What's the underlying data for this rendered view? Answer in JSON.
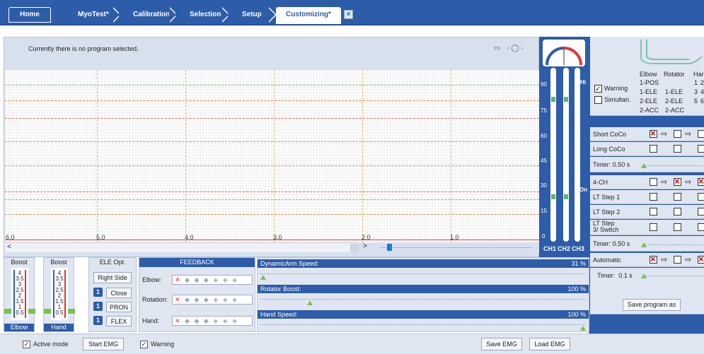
{
  "nav": {
    "home": "Home",
    "crumbs": [
      "MyoTest*",
      "Calibration",
      "Selection",
      "Setup"
    ],
    "active": "Customizing*"
  },
  "plot": {
    "status": "Currently there is no program selected.",
    "x_ticks": [
      "6.0",
      "5.0",
      "4.0",
      "3.0",
      "2.0",
      "1.0"
    ],
    "scroll_left": "<",
    "scroll_right": ">"
  },
  "meters": {
    "ticks": [
      "90",
      "75",
      "60",
      "45",
      "30",
      "15",
      "0"
    ],
    "hi_label": "Hi",
    "on_label": "On",
    "channels": [
      "CH1",
      "CH2",
      "CH3"
    ]
  },
  "settings": {
    "warning": "Warning",
    "simultan": "Simultan.",
    "col_elbow": "Elbow",
    "col_rotator": "Rotator",
    "col_hand": "Hand",
    "elbow_modes": [
      "1-POS",
      "1-ELE",
      "2-ELE",
      "2-ACC"
    ],
    "rotator_modes": [
      "1-ELE",
      "2-ELE",
      "2-ACC"
    ],
    "hand_nums": [
      "1",
      "2",
      "3",
      "4",
      "5",
      "6"
    ],
    "short_coco": "Short CoCo",
    "long_coco": "Long CoCo",
    "timer1": "Timer:",
    "timer1_val": "0.50 s",
    "four_ch": "4-CH",
    "lt1": "LT Step 1",
    "lt2": "LT Step 2",
    "lt3": "LT Step 3/ Switch",
    "timer2": "Timer:",
    "timer2_val": "0.50 s",
    "automatic": "Automatic",
    "timer3": "Timer:",
    "timer3_val": "0.1 s",
    "save_program": "Save program as"
  },
  "boost": {
    "header": "Boost",
    "values": [
      "4",
      "3.5",
      "3",
      "2.5",
      "2",
      "1.5",
      "1",
      "0.5"
    ],
    "elbow": "Elbow",
    "hand": "Hand"
  },
  "eleopt": {
    "header": "ELE Opt.",
    "right_side": "Right Side",
    "close": "Close",
    "pron": "PRON",
    "flex": "FLEX",
    "badge": "1"
  },
  "feedback": {
    "header": "FEEDBACK",
    "elbow": "Elbow:",
    "rotation": "Rotation:",
    "hand": "Hand:"
  },
  "speeds": {
    "dynamic": "DynamicArm Speed:",
    "dynamic_pct": "31 %",
    "dynamic_val": 31,
    "rotator": "Rotator Boost:",
    "rotator_pct": "100 %",
    "rotator_val": 100,
    "hand": "Hand Speed:",
    "hand_pct": "100 %",
    "hand_val": 100
  },
  "footer": {
    "active_mode": "Active mode",
    "start_emg": "Start EMG",
    "warning": "Warning",
    "save_emg": "Save EMG",
    "load_emg": "Load EMG"
  },
  "colors": {
    "accent": "#2d5ca8",
    "panel": "#dfe6f1",
    "red": "#e13a3a",
    "green": "#7ac24a"
  }
}
